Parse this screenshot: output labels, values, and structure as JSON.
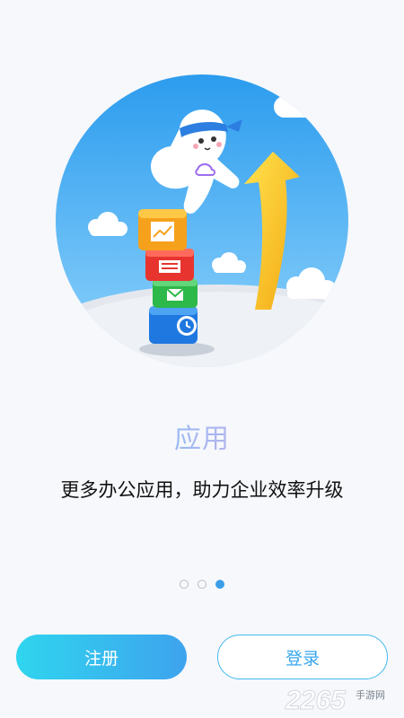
{
  "feature": {
    "title": "应用",
    "description": "更多办公应用，助力企业效率升级"
  },
  "pager": {
    "total": 3,
    "active_index": 3
  },
  "buttons": {
    "register_label": "注册",
    "login_label": "登录"
  },
  "watermark": {
    "brand_number": "2265",
    "brand_text": "手游网"
  },
  "colors": {
    "background": "#f6f8fb",
    "accent": "#3d9ee8",
    "register_gradient_start": "#2fd5ee",
    "register_gradient_end": "#3ea3ee",
    "login_border": "#45b8ee"
  }
}
